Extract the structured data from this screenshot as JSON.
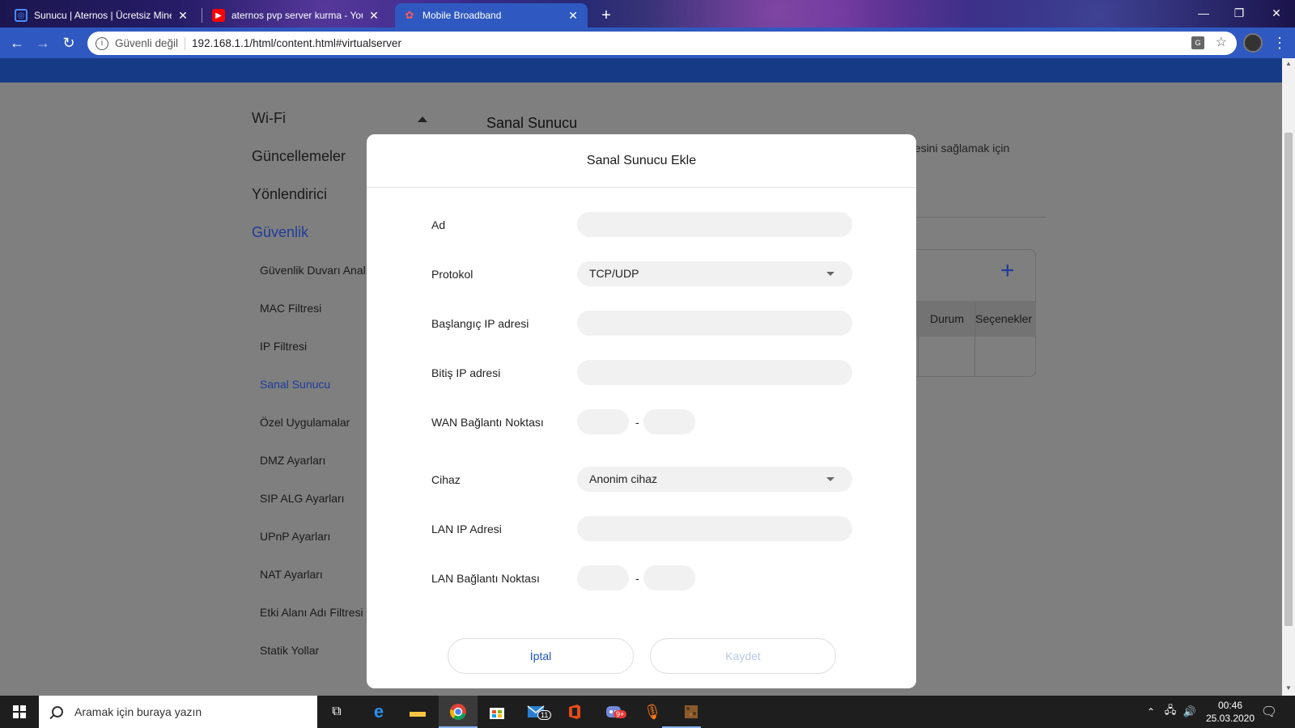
{
  "browser": {
    "tabs": [
      {
        "title": "Sunucu | Aternos | Ücretsiz Mine",
        "favicon": "aternos-icon",
        "active": false
      },
      {
        "title": "aternos pvp server kurma - YouTu",
        "favicon": "youtube-icon",
        "active": false
      },
      {
        "title": "Mobile Broadband",
        "favicon": "huawei-icon",
        "active": true
      }
    ],
    "new_tab": "+",
    "address": {
      "security": "Güvenli değil",
      "url": "192.168.1.1/html/content.html#virtualserver"
    }
  },
  "sidebar": {
    "main": [
      "Wi-Fi",
      "Güncellemeler",
      "Yönlendirici",
      "Güvenlik"
    ],
    "active_main": "Güvenlik",
    "sub": [
      "Güvenlik Duvarı Anal",
      "MAC Filtresi",
      "IP Filtresi",
      "Sanal Sunucu",
      "Özel Uygulamalar",
      "DMZ Ayarları",
      "SIP ALG Ayarları",
      "UPnP Ayarları",
      "NAT Ayarları",
      "Etki Alanı Adı Filtresi",
      "Statik Yollar"
    ],
    "active_sub": "Sanal Sunucu"
  },
  "background": {
    "title": "Sanal Sunucu",
    "desc_fragment": "nesini sağlamak için",
    "add_symbol": "+",
    "columns": [
      "Durum",
      "Seçenekler"
    ]
  },
  "modal": {
    "title": "Sanal Sunucu Ekle",
    "fields": {
      "name": {
        "label": "Ad",
        "value": ""
      },
      "protocol": {
        "label": "Protokol",
        "value": "TCP/UDP"
      },
      "start_ip": {
        "label": "Başlangıç IP adresi",
        "value": ""
      },
      "end_ip": {
        "label": "Bitiş IP adresi",
        "value": ""
      },
      "wan_port": {
        "label": "WAN Bağlantı Noktası",
        "from": "",
        "to": ""
      },
      "device": {
        "label": "Cihaz",
        "value": "Anonim cihaz"
      },
      "lan_ip": {
        "label": "LAN IP Adresi",
        "value": ""
      },
      "lan_port": {
        "label": "LAN Bağlantı Noktası",
        "from": "",
        "to": ""
      }
    },
    "dash": "-",
    "cancel": "İptal",
    "save": "Kaydet"
  },
  "taskbar": {
    "search_placeholder": "Aramak için buraya yazın",
    "time": "00:46",
    "date": "25.03.2020",
    "mail_badge": "11",
    "discord_badge": "9+"
  },
  "colors": {
    "chrome_toolbar": "#2f59c0",
    "accent": "#1e3c9a",
    "overlay": "#7f7f7f"
  }
}
